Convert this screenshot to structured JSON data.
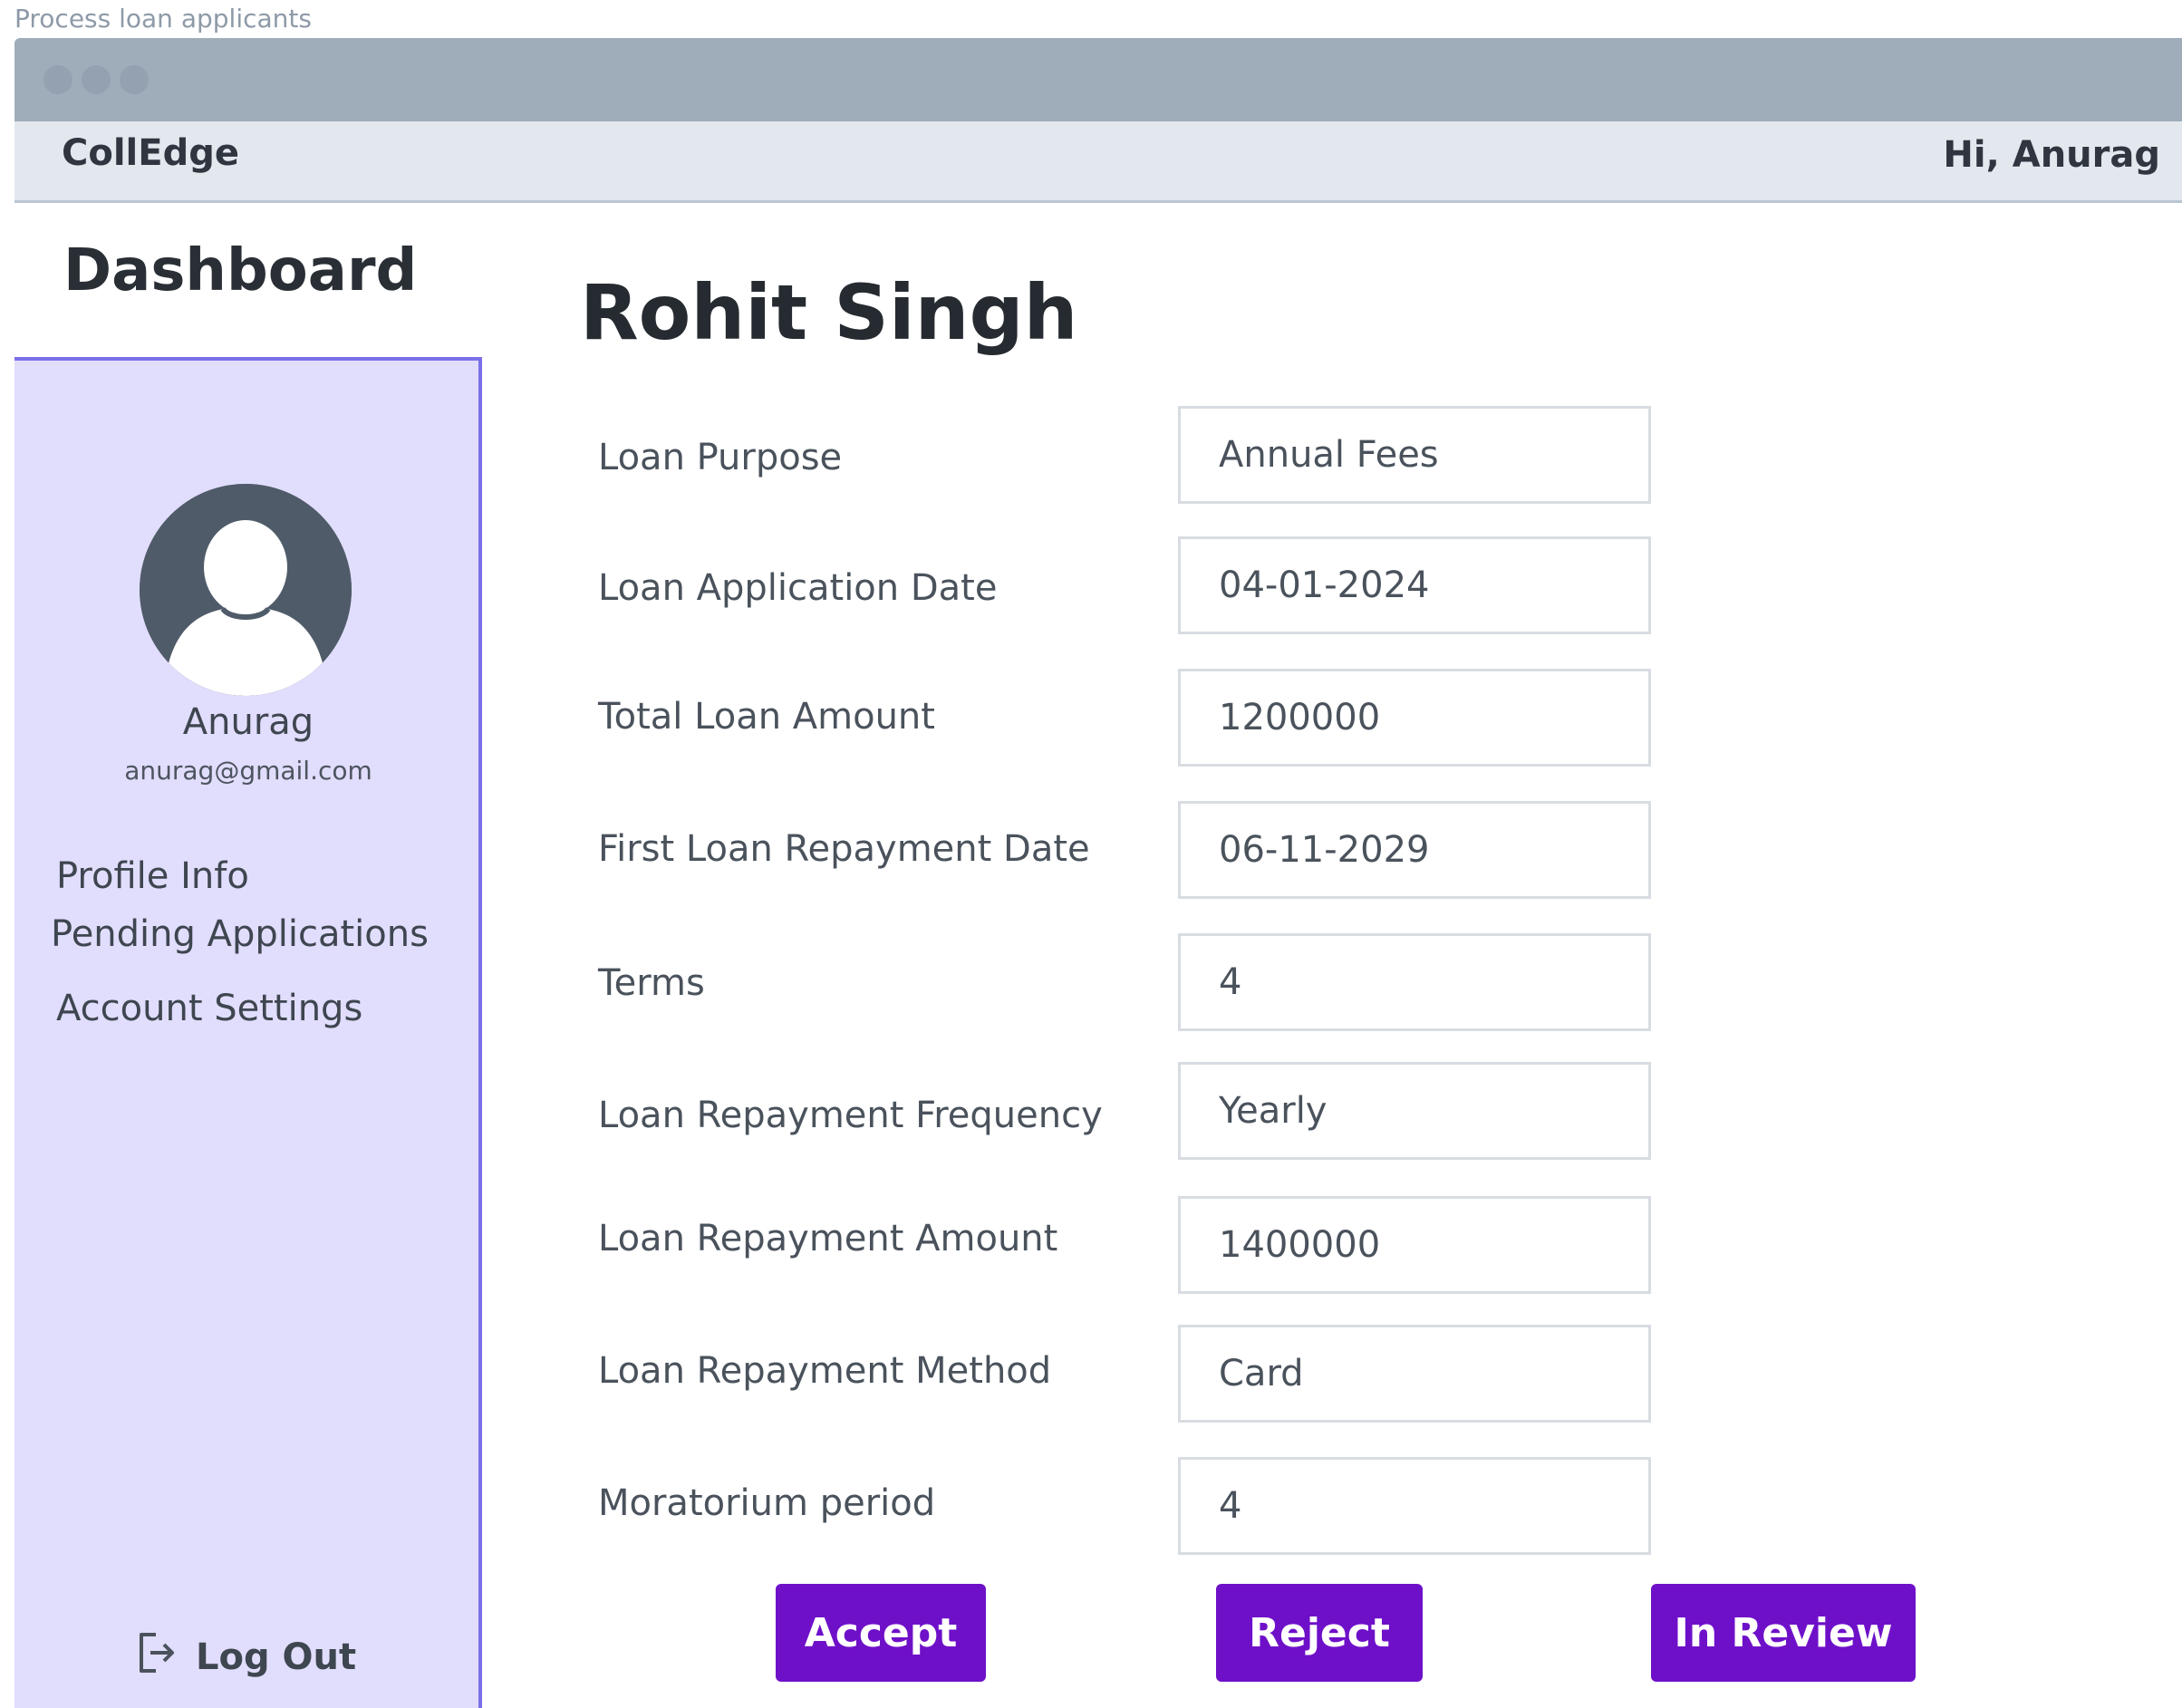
{
  "page_caption": "Process loan applicants",
  "header": {
    "brand": "CollEdge",
    "greeting": "Hi, Anurag"
  },
  "sidebar": {
    "title": "Dashboard",
    "user": {
      "name": "Anurag",
      "email": "anurag@gmail.com",
      "avatar_icon": "user-avatar-icon"
    },
    "items": [
      {
        "label": "Profile Info"
      },
      {
        "label": "Pending Applications"
      },
      {
        "label": "Account Settings"
      }
    ],
    "logout": {
      "label": "Log Out",
      "icon": "logout-icon"
    }
  },
  "applicant": {
    "name": "Rohit Singh",
    "fields": [
      {
        "label": "Loan Purpose",
        "value": "Annual Fees"
      },
      {
        "label": "Loan Application Date",
        "value": "04-01-2024"
      },
      {
        "label": "Total Loan Amount",
        "value": "1200000"
      },
      {
        "label": "First Loan Repayment Date",
        "value": "06-11-2029"
      },
      {
        "label": "Terms",
        "value": "4"
      },
      {
        "label": "Loan Repayment Frequency",
        "value": "Yearly"
      },
      {
        "label": "Loan Repayment Amount",
        "value": "1400000"
      },
      {
        "label": "Loan Repayment Method",
        "value": "Card"
      },
      {
        "label": "Moratorium period",
        "value": "4"
      }
    ]
  },
  "actions": {
    "accept": "Accept",
    "reject": "Reject",
    "in_review": "In Review"
  },
  "colors": {
    "accent_button": "#6f10c9",
    "sidebar_bg": "#e1ddfc",
    "sidebar_border": "#7a6fe8"
  }
}
